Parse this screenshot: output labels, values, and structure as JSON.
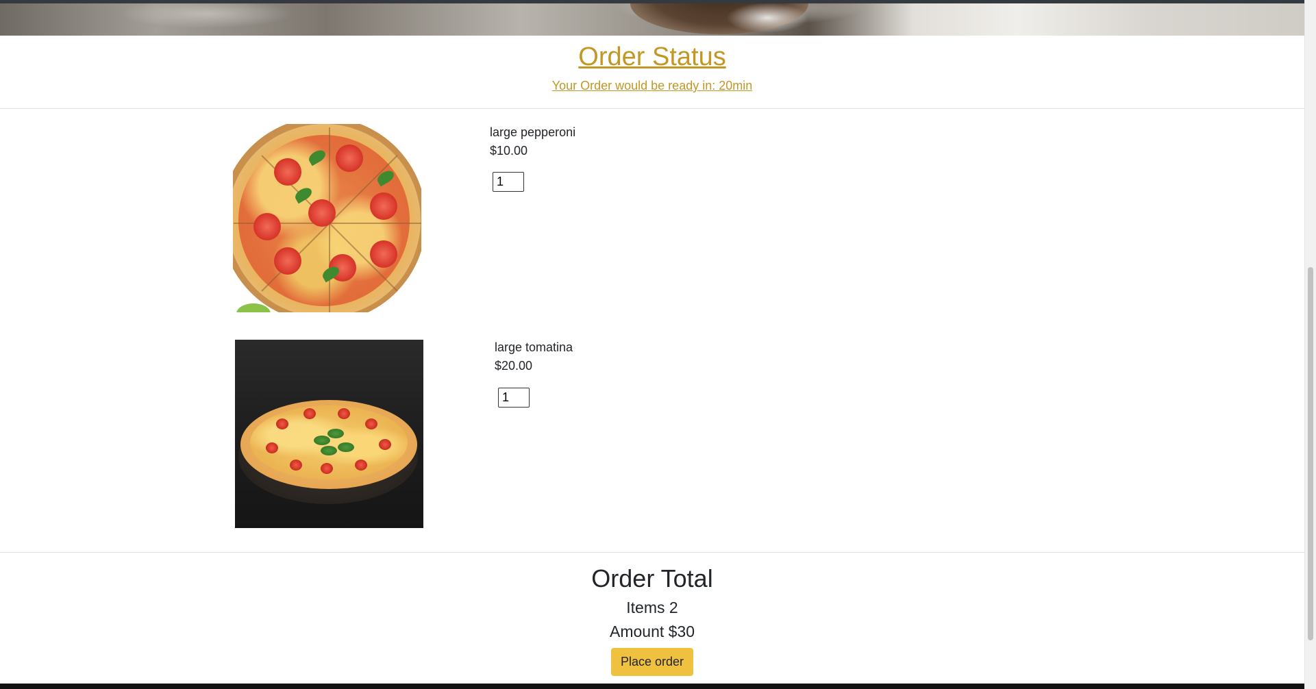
{
  "status": {
    "title": "Order Status",
    "subtitle": "Your Order would be ready in: 20min"
  },
  "items": [
    {
      "name": "large pepperoni",
      "price": "$10.00",
      "quantity": "1",
      "image_icon": "pizza-on-board-photo"
    },
    {
      "name": "large tomatina",
      "price": "$20.00",
      "quantity": "1",
      "image_icon": "pizza-dark-background-photo"
    }
  ],
  "total": {
    "title": "Order Total",
    "items_text": "Items 2",
    "amount_text": "Amount $30",
    "button_label": "Place order"
  },
  "colors": {
    "accent": "#c29723",
    "button": "#f0c03f",
    "text": "#212529",
    "divider": "#dee2e6"
  }
}
